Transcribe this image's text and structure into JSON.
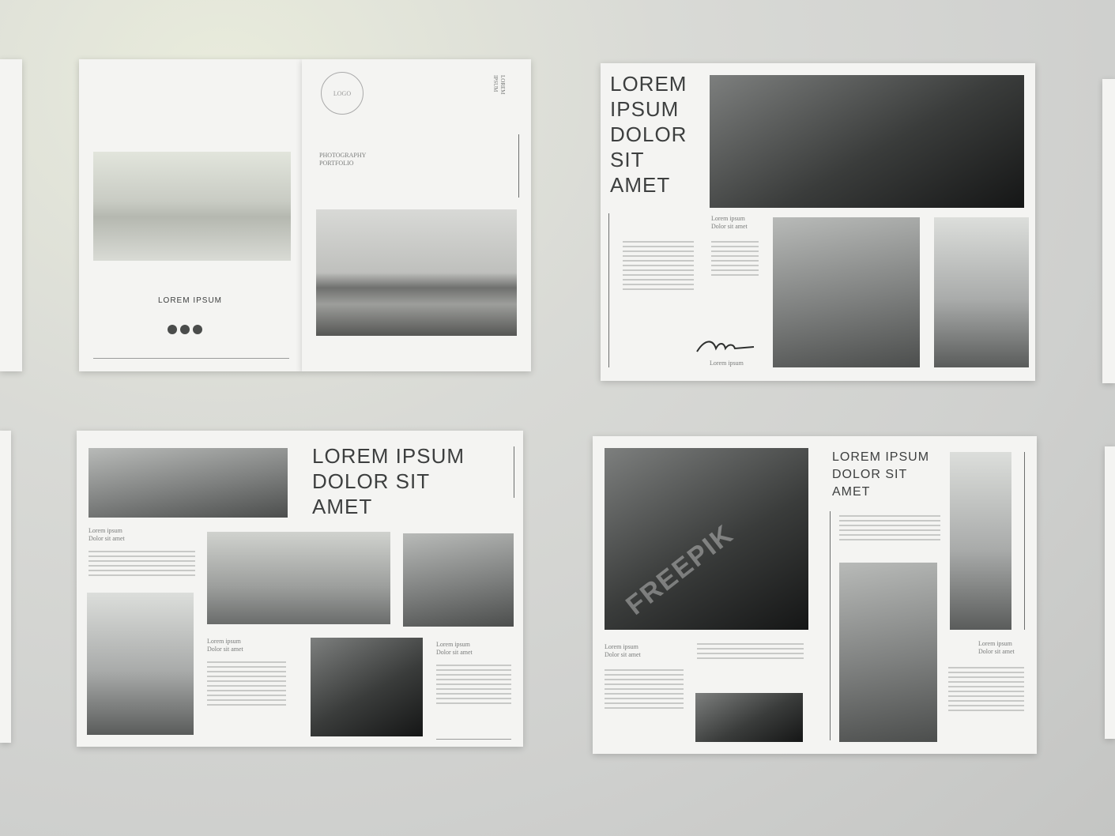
{
  "spread1": {
    "logo_text": "LOGO",
    "side_label": "LOREM IPSUM",
    "subtitle_line1": "PHOTOGRAPHY",
    "subtitle_line2": "PORTFOLIO",
    "cover_title": "LOREM IPSUM",
    "dots": 3
  },
  "spread2": {
    "title_lines": [
      "LOREM",
      "IPSUM",
      "DOLOR",
      "SIT",
      "AMET"
    ],
    "caption_line1": "Lorem ipsum",
    "caption_line2": "Dolor sit amet",
    "signature_caption": "Lorem ipsum"
  },
  "spread3": {
    "title_lines": [
      "LOREM IPSUM",
      "DOLOR SIT",
      "AMET"
    ],
    "caption_line1": "Lorem ipsum",
    "caption_line2": "Dolor sit amet"
  },
  "spread4": {
    "title_lines": [
      "LOREM IPSUM",
      "DOLOR SIT",
      "AMET"
    ],
    "caption_line1": "Lorem ipsum",
    "caption_line2": "Dolor sit amet"
  },
  "watermark": "FREEPIK"
}
